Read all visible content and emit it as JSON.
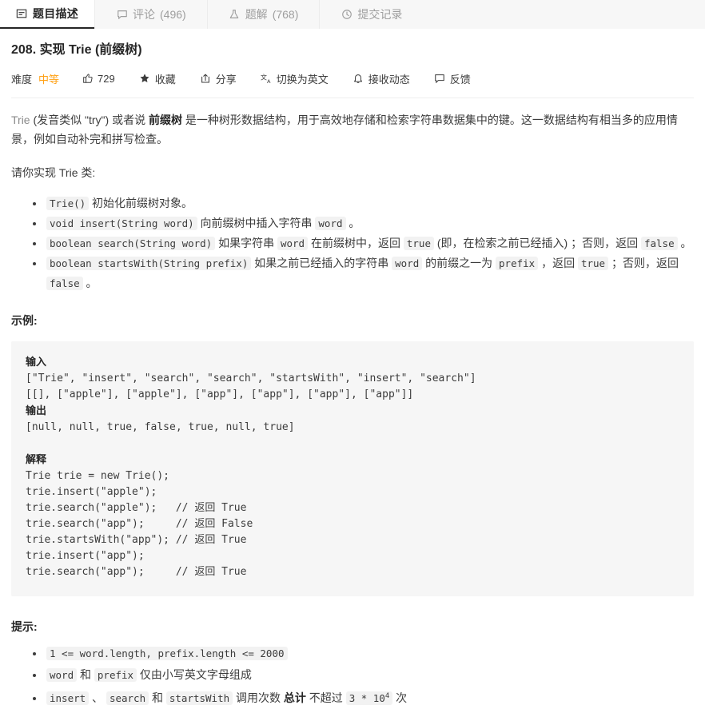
{
  "tabs": [
    {
      "label": "题目描述",
      "count": "",
      "icon": "description-icon",
      "active": true,
      "name": "tab-description"
    },
    {
      "label": "评论",
      "count": "(496)",
      "icon": "comment-icon",
      "active": false,
      "name": "tab-comments"
    },
    {
      "label": "题解",
      "count": "(768)",
      "icon": "flask-icon",
      "active": false,
      "name": "tab-solutions"
    },
    {
      "label": "提交记录",
      "count": "",
      "icon": "clock-icon",
      "active": false,
      "name": "tab-submissions"
    }
  ],
  "problem": {
    "title": "208. 实现 Trie (前缀树)",
    "difficulty_label": "难度",
    "difficulty_value": "中等",
    "difficulty_color": "#ffa116"
  },
  "actions": [
    {
      "label": "729",
      "icon": "thumbs-up-icon",
      "name": "like-button"
    },
    {
      "label": "收藏",
      "icon": "star-icon",
      "name": "favorite-button"
    },
    {
      "label": "分享",
      "icon": "share-icon",
      "name": "share-button"
    },
    {
      "label": "切换为英文",
      "icon": "translate-icon",
      "name": "switch-language-button"
    },
    {
      "label": "接收动态",
      "icon": "bell-icon",
      "name": "subscribe-button"
    },
    {
      "label": "反馈",
      "icon": "feedback-icon",
      "name": "feedback-button"
    }
  ],
  "description": {
    "p1_term": "Trie",
    "p1_a": " (发音类似 \"try\") 或者说 ",
    "p1_b": "前缀树",
    "p1_c": " 是一种树形数据结构，用于高效地存储和检索字符串数据集中的键。这一数据结构有相当多的应用情景，例如自动补完和拼写检查。",
    "implement_line": "请你实现 Trie 类:",
    "methods": [
      {
        "code": "Trie()",
        "text": " 初始化前缀树对象。"
      },
      {
        "code": "void insert(String word)",
        "text_a": " 向前缀树中插入字符串 ",
        "code2": "word",
        "text_b": " 。"
      },
      {
        "code": "boolean search(String word)",
        "text_a": " 如果字符串 ",
        "code2": "word",
        "text_b": " 在前缀树中，返回 ",
        "code3": "true",
        "text_c": " (即，在检索之前已经插入) ；否则，返回 ",
        "code4": "false",
        "text_d": " 。"
      },
      {
        "code": "boolean startsWith(String prefix)",
        "text_a": " 如果之前已经插入的字符串 ",
        "code2": "word",
        "text_b": " 的前缀之一为 ",
        "code3": "prefix",
        "text_c": " ，返回 ",
        "code4": "true",
        "text_d": " ；否则，返回 ",
        "code5": "false",
        "text_e": " 。"
      }
    ]
  },
  "example": {
    "heading": "示例:",
    "input_label": "输入",
    "input_lines": [
      "[\"Trie\", \"insert\", \"search\", \"search\", \"startsWith\", \"insert\", \"search\"]",
      "[[], [\"apple\"], [\"apple\"], [\"app\"], [\"app\"], [\"app\"], [\"app\"]]"
    ],
    "output_label": "输出",
    "output_lines": [
      "[null, null, true, false, true, null, true]"
    ],
    "explain_label": "解释",
    "explain_lines": [
      "Trie trie = new Trie();",
      "trie.insert(\"apple\");",
      "trie.search(\"apple\");   // 返回 True",
      "trie.search(\"app\");     // 返回 False",
      "trie.startsWith(\"app\"); // 返回 True",
      "trie.insert(\"app\");",
      "trie.search(\"app\");     // 返回 True"
    ]
  },
  "hints": {
    "heading": "提示:",
    "items": [
      {
        "c1": "1 <= word.length, prefix.length <= 2000"
      },
      {
        "c1": "word",
        "t1": " 和 ",
        "c2": "prefix",
        "t2": " 仅由小写英文字母组成"
      },
      {
        "c1": "insert",
        "t1": " 、 ",
        "c2": "search",
        "t2": " 和 ",
        "c3": "startsWith",
        "t3": " 调用次数 ",
        "b1": "总计",
        "t4": " 不超过 ",
        "c4": "3 * 10",
        "sup": "4",
        "t5": " 次"
      }
    ]
  }
}
